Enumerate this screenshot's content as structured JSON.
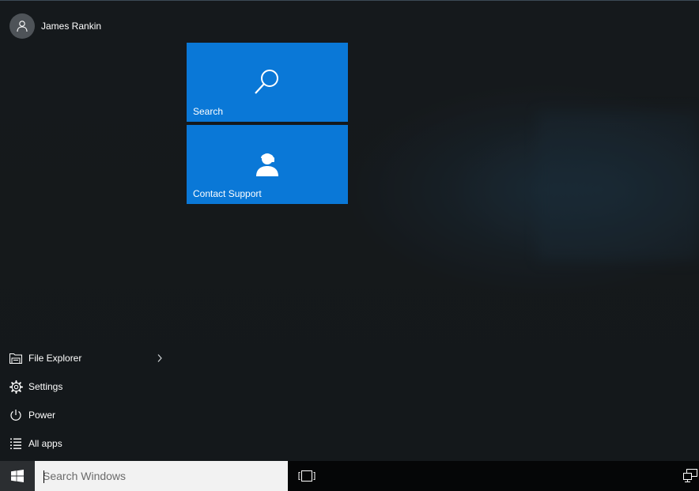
{
  "user": {
    "name": "James Rankin",
    "avatar_icon": "user-avatar-icon"
  },
  "tiles": [
    {
      "label": "Search",
      "icon": "search-icon",
      "color": "#0a78d7"
    },
    {
      "label": "Contact Support",
      "icon": "contact-support-icon",
      "color": "#0a78d7"
    }
  ],
  "nav": {
    "file_explorer": {
      "label": "File Explorer",
      "icon": "file-explorer-icon",
      "chevron": "chevron-right-icon"
    },
    "settings": {
      "label": "Settings",
      "icon": "gear-icon"
    },
    "power": {
      "label": "Power",
      "icon": "power-icon"
    },
    "all_apps": {
      "label": "All apps",
      "icon": "list-icon"
    }
  },
  "taskbar": {
    "start_icon": "windows-logo-icon",
    "search_placeholder": "Search Windows",
    "task_view_icon": "task-view-icon",
    "network_icon": "network-icon"
  }
}
